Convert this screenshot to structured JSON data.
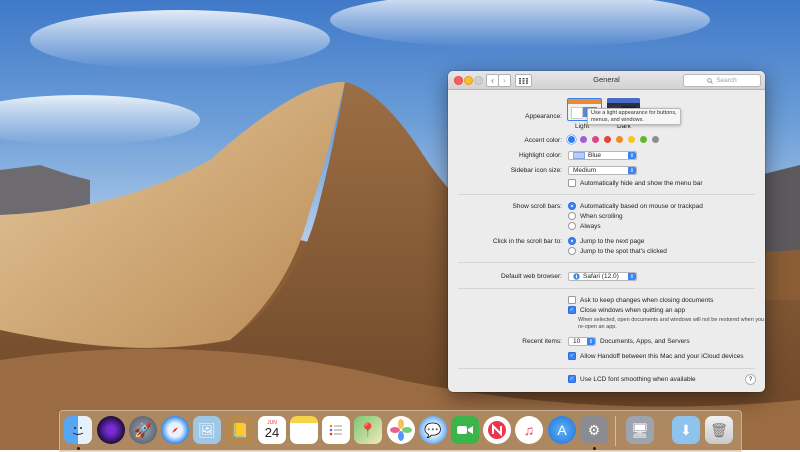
{
  "window": {
    "title": "General",
    "search_placeholder": "Search",
    "nav_back": "‹",
    "nav_forward": "›",
    "grid_icon": "⋮⋮⋮"
  },
  "appearance": {
    "label": "Appearance:",
    "options": [
      "Light",
      "Dark"
    ],
    "selected": "Light",
    "tooltip": "Use a light appearance for buttons, menus, and windows."
  },
  "accent_color": {
    "label": "Accent color:",
    "colors": [
      "#2f7bf6",
      "#a25fd3",
      "#e0458b",
      "#e2453c",
      "#f08a24",
      "#f5c629",
      "#5fb536",
      "#8e8e93"
    ]
  },
  "highlight_color": {
    "label": "Highlight color:",
    "value": "Blue",
    "swatch": "#b5cffa"
  },
  "sidebar_icon_size": {
    "label": "Sidebar icon size:",
    "value": "Medium"
  },
  "menu_bar": {
    "label": "Automatically hide and show the menu bar",
    "checked": false
  },
  "scroll_bars": {
    "label": "Show scroll bars:",
    "options": [
      "Automatically based on mouse or trackpad",
      "When scrolling",
      "Always"
    ],
    "selected": 0
  },
  "click_scroll_bar": {
    "label": "Click in the scroll bar to:",
    "options": [
      "Jump to the next page",
      "Jump to the spot that's clicked"
    ],
    "selected": 0
  },
  "default_browser": {
    "label": "Default web browser:",
    "value": "Safari (12.0)"
  },
  "documents": {
    "ask_keep": "Ask to keep changes when closing documents",
    "ask_keep_checked": false,
    "close_windows": "Close windows when quitting an app",
    "close_windows_checked": true,
    "note": "When selected, open documents and windows will not be restored when you re-open an app."
  },
  "recent_items": {
    "label": "Recent items:",
    "value": "10",
    "suffix": "Documents, Apps, and Servers"
  },
  "handoff": {
    "label": "Allow Handoff between this Mac and your iCloud devices",
    "checked": true
  },
  "lcd": {
    "label": "Use LCD font smoothing when available",
    "checked": true
  },
  "help": "?",
  "dock": {
    "calendar_month": "JUN",
    "calendar_day": "24",
    "apps": [
      "finder",
      "siri",
      "launchpad",
      "safari",
      "preview",
      "contacts",
      "calendar",
      "notes",
      "reminders",
      "maps",
      "photos",
      "messages",
      "facetime",
      "news",
      "music",
      "app-store",
      "system-preferences",
      "image-capture",
      "downloads",
      "trash"
    ]
  }
}
